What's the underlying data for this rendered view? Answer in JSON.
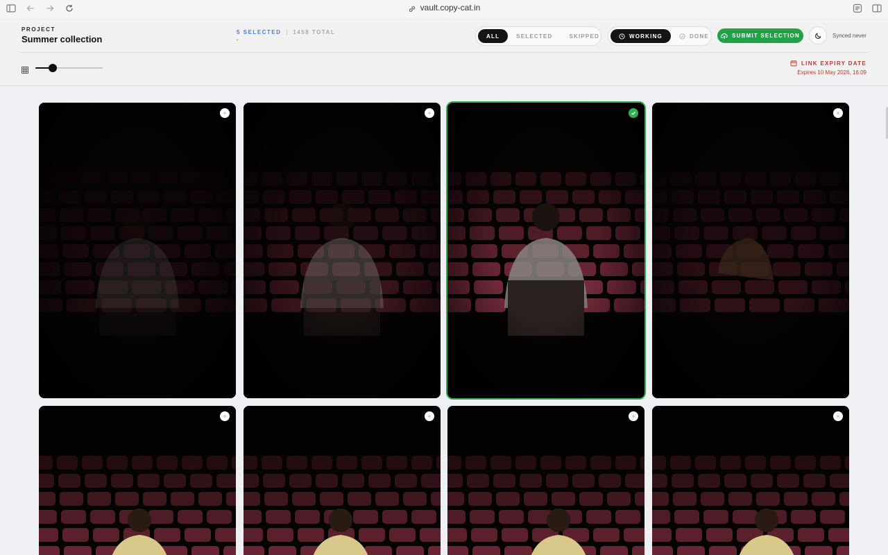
{
  "browser": {
    "url": "vault.copy-cat.in"
  },
  "header": {
    "project_label": "PROJECT",
    "project_title": "Summer collection",
    "selected_count": "5 SELECTED",
    "total_count": "1458 TOTAL",
    "filter_tabs": [
      {
        "label": "ALL",
        "active": true
      },
      {
        "label": "SELECTED",
        "active": false
      },
      {
        "label": "SKIPPED",
        "active": false
      }
    ],
    "status_tabs": [
      {
        "label": "WORKING",
        "icon": "clock-icon",
        "active": true
      },
      {
        "label": "DONE",
        "icon": "check-circle-icon",
        "active": false
      }
    ],
    "submit_label": "SUBMIT SELECTION",
    "synced_text": "Synced never",
    "zoom_level": 0.22,
    "expiry_label": "LINK EXPIRY DATE",
    "expiry_date": "Expires 10 May 2026, 16:09"
  },
  "colors": {
    "accent_blue": "#4a7fd6",
    "submit_green": "#22a248",
    "selected_outline": "#2fb24e",
    "expiry_red": "#c0392b",
    "seat_pink": "#7a2c3d"
  },
  "gallery": {
    "photos": [
      {
        "selected": false
      },
      {
        "selected": false
      },
      {
        "selected": true
      },
      {
        "selected": false
      },
      {
        "selected": false
      },
      {
        "selected": false
      },
      {
        "selected": false
      },
      {
        "selected": false
      }
    ]
  }
}
